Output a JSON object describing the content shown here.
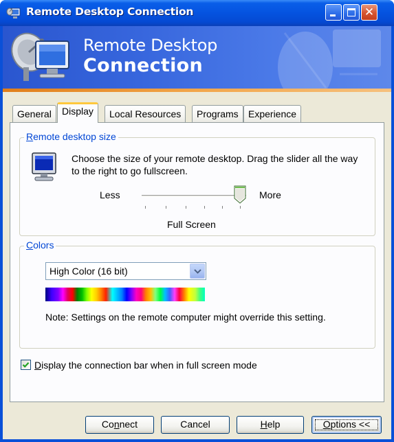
{
  "window": {
    "title": "Remote Desktop Connection"
  },
  "banner": {
    "line1": "Remote Desktop",
    "line2": "Connection"
  },
  "tabs": [
    {
      "label": "General",
      "active": false
    },
    {
      "label": "Display",
      "active": true
    },
    {
      "label": "Local Resources",
      "active": false
    },
    {
      "label": "Programs",
      "active": false
    },
    {
      "label": "Experience",
      "active": false
    }
  ],
  "remote_size": {
    "legend_prefix": "R",
    "legend_rest": "emote desktop size",
    "description": "Choose the size of your remote desktop. Drag the slider all the way to the right to go fullscreen.",
    "less_label": "Less",
    "more_label": "More",
    "value_label": "Full Screen",
    "slider_position": 1.0
  },
  "colors": {
    "legend_prefix": "C",
    "legend_rest": "olors",
    "selected": "High Color (16 bit)",
    "note": "Note: Settings on the remote computer might override this setting."
  },
  "connection_bar": {
    "checked": true,
    "label_prefix": "D",
    "label_rest": "isplay the connection bar when in full screen mode"
  },
  "buttons": {
    "connect_prefix": "Co",
    "connect_mnemonic": "n",
    "connect_rest": "nect",
    "cancel": "Cancel",
    "help_mnemonic": "H",
    "help_rest": "elp",
    "options_mnemonic": "O",
    "options_rest": "ptions <<"
  },
  "colors_theme": {
    "titlebar": "#0553e0",
    "tab_highlight": "#ffc83c",
    "legend_text": "#0046d5"
  }
}
